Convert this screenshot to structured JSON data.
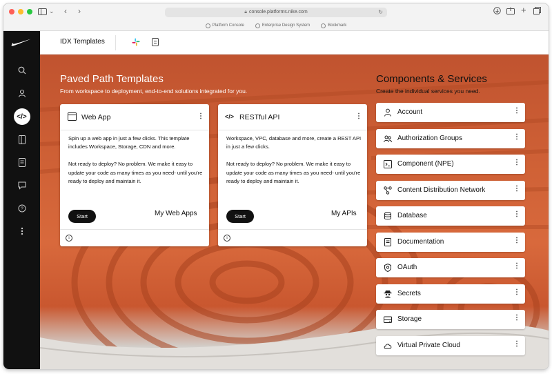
{
  "browser": {
    "url": "console.platforms.nike.com",
    "bookmarks": [
      "Platform Console",
      "Enterprise Design System",
      "Bookmark"
    ]
  },
  "appbar": {
    "title": "IDX Templates"
  },
  "rail": {
    "items": [
      "search-icon",
      "user-icon",
      "code-icon",
      "notebook-icon",
      "document-icon",
      "chat-icon",
      "help-icon",
      "more-icon"
    ],
    "active": "code-icon"
  },
  "paved": {
    "title": "Paved Path Templates",
    "subtitle": "From workspace to deployment, end-to-end solutions integrated for you.",
    "cards": [
      {
        "title": "Web App",
        "description": "Spin up a web app in just a few clicks. This template includes Workspace, Storage, CDN  and more.\n\nNot ready to deploy? No problem. We make it easy to update your code as many times as you need- until you're ready to deploy and maintain it.",
        "start_label": "Start",
        "link_label": "My Web Apps"
      },
      {
        "title": "RESTful API",
        "description": "Workspace, VPC, database and more, create a REST API in just a few clicks.\n\nNot ready to deploy? No problem. We make it easy to update your code as many times as you need- until you're ready to deploy and maintain it.",
        "start_label": "Start",
        "link_label": "My APIs"
      }
    ]
  },
  "components": {
    "title": "Components & Services",
    "subtitle": "Create the individual services you need.",
    "items": [
      {
        "label": "Account",
        "icon": "person-icon"
      },
      {
        "label": "Authorization Groups",
        "icon": "group-icon"
      },
      {
        "label": "Component (NPE)",
        "icon": "terminal-icon"
      },
      {
        "label": "Content Distribution Network",
        "icon": "network-icon"
      },
      {
        "label": "Database",
        "icon": "database-icon"
      },
      {
        "label": "Documentation",
        "icon": "document-icon"
      },
      {
        "label": "OAuth",
        "icon": "oauth-icon"
      },
      {
        "label": "Secrets",
        "icon": "secrets-icon"
      },
      {
        "label": "Storage",
        "icon": "storage-icon"
      },
      {
        "label": "Virtual Private Cloud",
        "icon": "cloud-icon"
      }
    ]
  },
  "colors": {
    "rail": "#111111",
    "accent": "#d8693c",
    "button": "#111111"
  }
}
